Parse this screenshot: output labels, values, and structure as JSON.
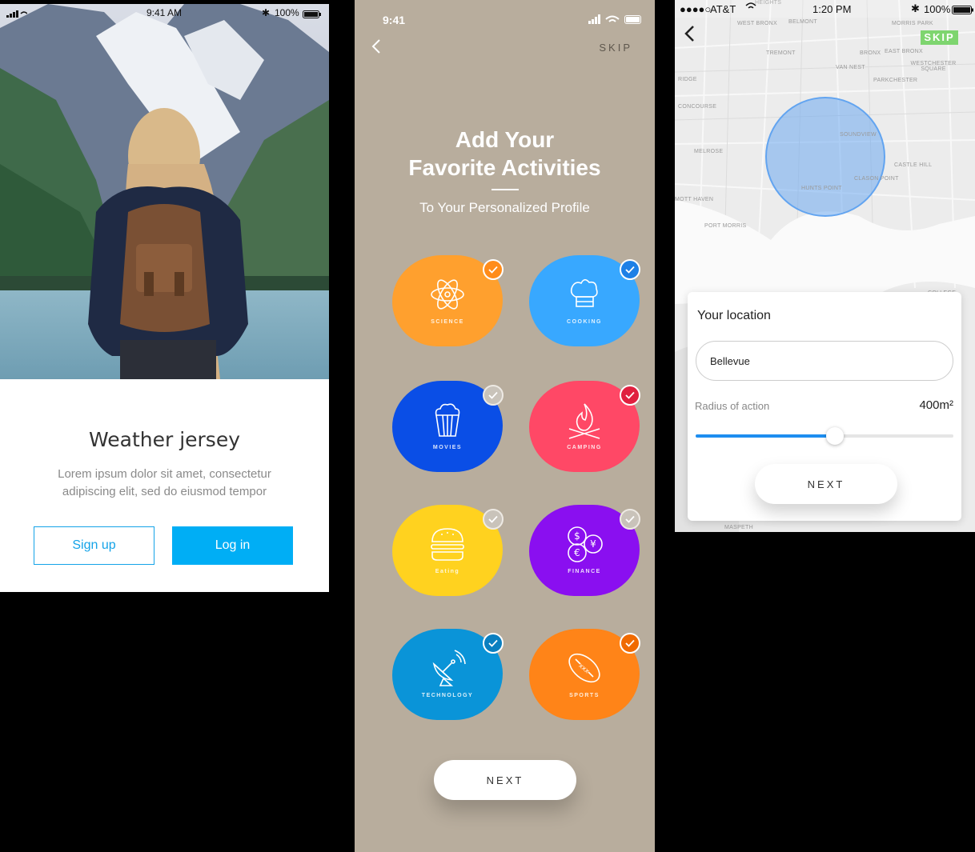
{
  "welcome": {
    "status": {
      "carrier": "",
      "time": "9:41 AM",
      "battery": "100%"
    },
    "title": "Weather jersey",
    "description": "Lorem ipsum dolor sit amet, consectetur adipiscing elit, sed do eiusmod tempor",
    "signup_label": "Sign up",
    "login_label": "Log in"
  },
  "activities_screen": {
    "status": {
      "time": "9:41"
    },
    "skip_label": "SKIP",
    "heading_line1": "Add Your",
    "heading_line2": "Favorite Activities",
    "subheading": "To Your Personalized Profile",
    "next_label": "NEXT",
    "activities": [
      {
        "label": "SCIENCE",
        "color": "#ffa02e",
        "check_color": "#ff8c1a",
        "selected": true,
        "icon": "atom-icon"
      },
      {
        "label": "COOKING",
        "color": "#38a8ff",
        "check_color": "#1e80e6",
        "selected": true,
        "icon": "chef-hat-icon"
      },
      {
        "label": "MOVIES",
        "color": "#0a4ee6",
        "check_color": "#c9c3ba",
        "selected": false,
        "icon": "popcorn-icon"
      },
      {
        "label": "CAMPING",
        "color": "#ff4866",
        "check_color": "#e0203f",
        "selected": true,
        "icon": "campfire-icon"
      },
      {
        "label": "Eating",
        "color": "#ffd21f",
        "check_color": "#c9c3ba",
        "selected": false,
        "icon": "burger-icon"
      },
      {
        "label": "FINANCE",
        "color": "#8a0ff0",
        "check_color": "#c9c3ba",
        "selected": false,
        "icon": "currency-icon"
      },
      {
        "label": "TECHNOLOGY",
        "color": "#0a94d8",
        "check_color": "#0a7fc0",
        "selected": true,
        "icon": "satellite-dish-icon"
      },
      {
        "label": "SPORTS",
        "color": "#ff8418",
        "check_color": "#f06a00",
        "selected": true,
        "icon": "football-icon"
      }
    ]
  },
  "location_screen": {
    "status": {
      "carrier": "AT&T",
      "time": "1:20 PM",
      "battery": "100%"
    },
    "skip_label": "SKIP",
    "card_title": "Your location",
    "location_value": "Bellevue",
    "radius_label": "Radius of action",
    "radius_value": "400m²",
    "radius_fraction": 0.54,
    "next_label": "NEXT",
    "map_labels": [
      "WEST BRONX",
      "BELMONT",
      "MORRIS PARK",
      "TREMONT",
      "BRONX",
      "EAST BRONX",
      "VAN NEST",
      "WESTCHESTER SQUARE",
      "PARKCHESTER",
      "SOUNDVIEW",
      "CONCOURSE",
      "MELROSE",
      "CASTLE HILL",
      "CLASON POINT",
      "HUNTS POINT",
      "MOTT HAVEN",
      "PORT MORRIS",
      "COLLEGE POINT",
      "MASPETH",
      "HEIGHTS",
      "RIDGE"
    ]
  }
}
